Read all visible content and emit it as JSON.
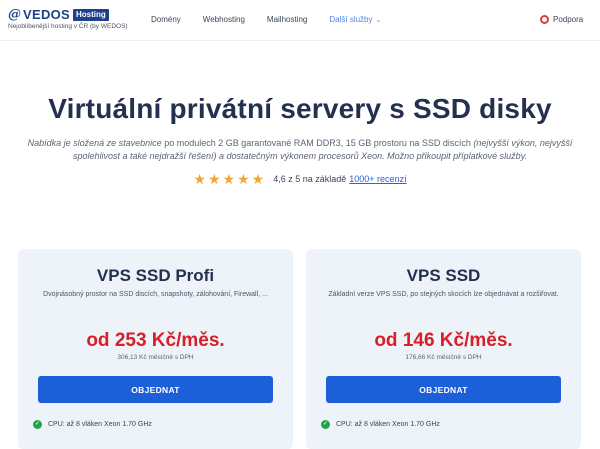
{
  "header": {
    "logo_at": "@",
    "logo_name": "VEDOS",
    "logo_badge": "Hosting",
    "logo_tagline": "Nejoblíbenější hosting v ČR (by WEDOS)",
    "nav": [
      {
        "label": "Domény"
      },
      {
        "label": "Webhosting"
      },
      {
        "label": "Mailhosting"
      },
      {
        "label": "Další služby"
      }
    ],
    "support_label": "Podpora"
  },
  "hero": {
    "title": "Virtuální privátní servery s SSD disky",
    "desc_part1": "Nabídka je složená ze stavebnice",
    "desc_part2": " po modulech 2 GB garantované RAM DDR3, 15 GB prostoru na SSD discích ",
    "desc_part3": "(nejvyšší výkon, nejvyšší spolehlivost a také nejdražší řešení)",
    "desc_part4": " a dostatečným výkonem procesorů Xeon. Možno přikoupit ",
    "desc_part5": "příplatkové služby.",
    "rating_value": 5,
    "rating_text": "4,6 z 5 na základě",
    "rating_link": "1000+ recenzí"
  },
  "cards": [
    {
      "title": "VPS SSD Profi",
      "desc": "Dvojnásobný prostor na SSD discích, snapshoty, zálohování, Firewall, ...",
      "price": "od 253 Kč/měs.",
      "price_vat": "306,13 Kč měsíčně s DPH",
      "button": "OBJEDNAT",
      "feature": "CPU: až 8 vláken Xeon 1.70 GHz"
    },
    {
      "title": "VPS SSD",
      "desc": "Základní verze VPS SSD, po stejných skocích lze objednávat a rozšiřovat.",
      "price": "od 146 Kč/měs.",
      "price_vat": "176,66 Kč měsíčně s DPH",
      "button": "OBJEDNAT",
      "feature": "CPU: až 8 vláken Xeon 1.70 GHz"
    }
  ],
  "colors": {
    "brand": "#1d3f8c",
    "accent_button": "#1b5fd9",
    "price": "#d61f26",
    "star": "#f2a531",
    "check": "#22a34a"
  },
  "icons": [
    "lifebuoy-icon",
    "chevron-down-icon",
    "star-icon",
    "check-icon"
  ]
}
